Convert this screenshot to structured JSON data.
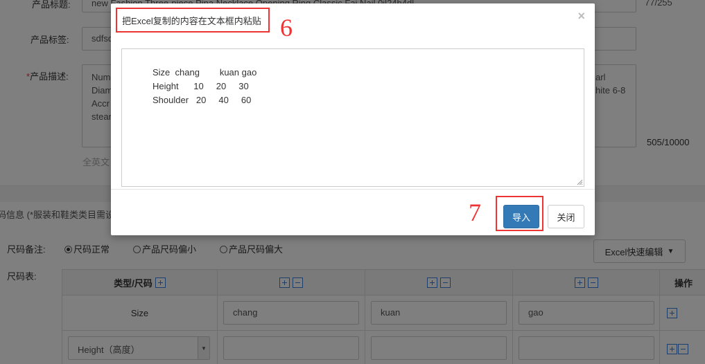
{
  "form": {
    "title_label": "产品标题:",
    "title_value": "new Fashion Three-piece Pipa Necklace Opening Ring Classic Fai Nail 0il24h4dl",
    "title_count": "77/255",
    "tag_label": "产品标签:",
    "tag_value": "sdfsd",
    "desc_required_mark": "*",
    "desc_label": "产品描述:",
    "desc_left_lines": [
      "Num",
      "Diam",
      "Accr",
      "stear"
    ],
    "desc_right_lines": [
      "arl",
      "",
      "hite 6-8",
      ""
    ],
    "desc_count": "505/10000",
    "desc_hint": "全英文"
  },
  "size_section": {
    "title": "码信息 (*服装和鞋类类目需设",
    "remark_label": "尺码备注:",
    "radio_options": [
      {
        "label": "尺码正常",
        "checked": true
      },
      {
        "label": "产品尺码偏小",
        "checked": false
      },
      {
        "label": "产品尺码偏大",
        "checked": false
      }
    ],
    "excel_button": "Excel快速编辑",
    "table_label": "尺码表:",
    "col_type_header": "类型/尺码",
    "col_action_header": "操作",
    "row1_label": "Size",
    "row1_values": [
      "chang",
      "kuan",
      "gao"
    ],
    "row2_select": "Height（高度）"
  },
  "modal": {
    "title": "把Excel复制的内容在文本框内粘贴",
    "close_glyph": "×",
    "textarea_value": "Size  chang        kuan gao\nHeight      10     20     30\nShoulder   20     40     60",
    "import_button": "导入",
    "close_button": "关闭",
    "annotation_step6": "6",
    "annotation_step7": "7"
  }
}
